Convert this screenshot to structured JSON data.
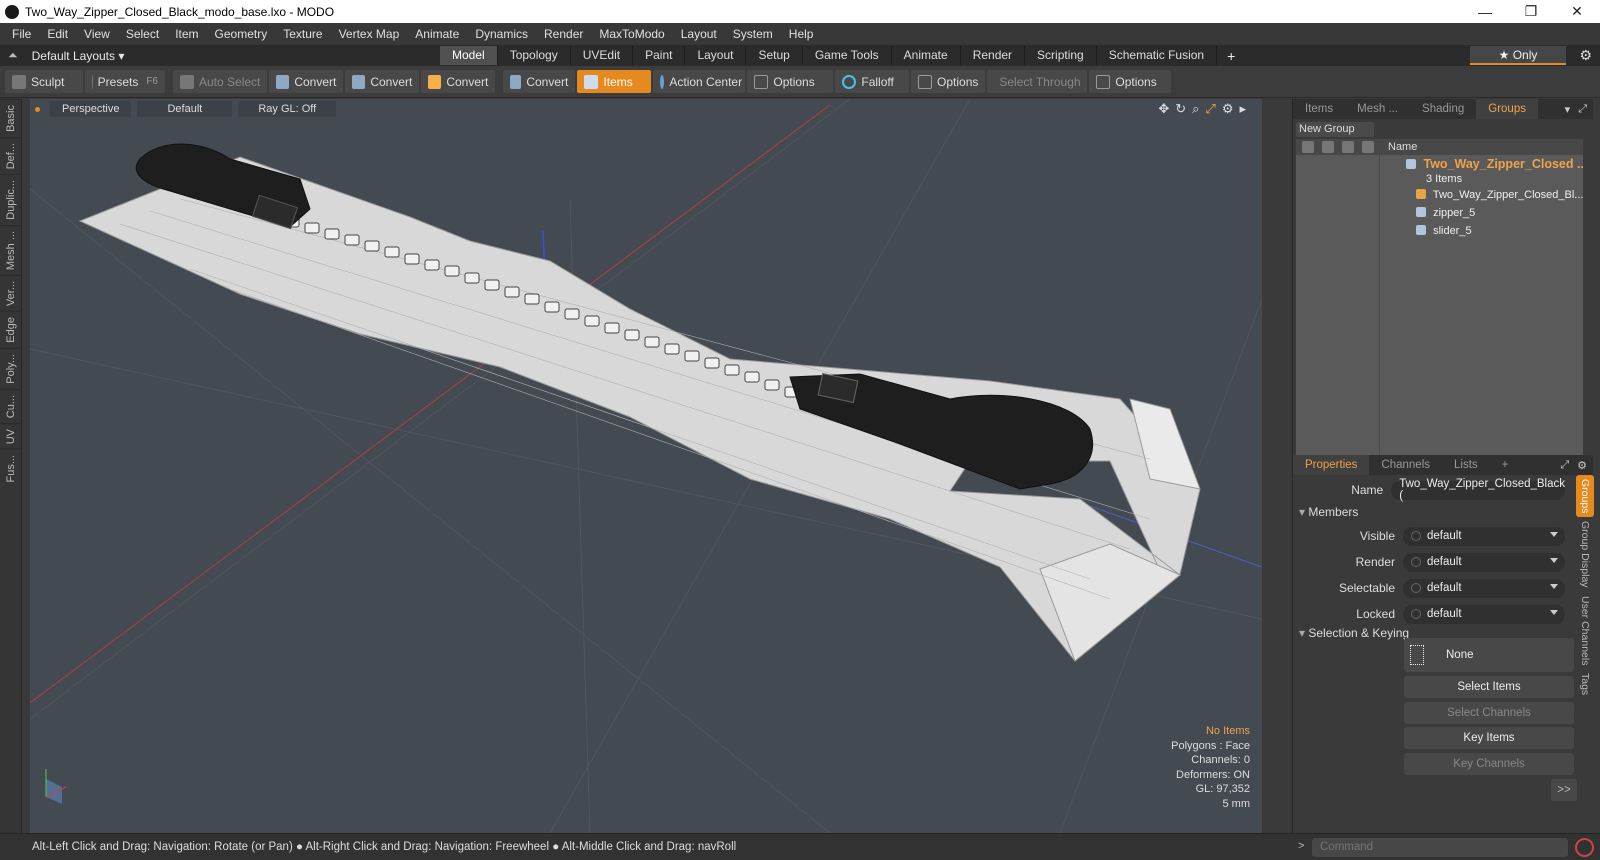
{
  "window": {
    "title": "Two_Way_Zipper_Closed_Black_modo_base.lxo - MODO",
    "minimize": "—",
    "maximize": "❐",
    "close": "✕"
  },
  "menu": [
    "File",
    "Edit",
    "View",
    "Select",
    "Item",
    "Geometry",
    "Texture",
    "Vertex Map",
    "Animate",
    "Dynamics",
    "Render",
    "MaxToModo",
    "Layout",
    "System",
    "Help"
  ],
  "layouts": {
    "dropdown": "Default Layouts ▾",
    "tabs": [
      "Model",
      "Topology",
      "UVEdit",
      "Paint",
      "Layout",
      "Setup",
      "Game Tools",
      "Animate",
      "Render",
      "Scripting",
      "Schematic Fusion"
    ],
    "active_tab": "Model",
    "plus": "+",
    "only": "★  Only",
    "gear": "⚙"
  },
  "toolbar": {
    "sculpt": "Sculpt",
    "presets": "Presets",
    "presets_key": "F6",
    "auto_select": "Auto Select",
    "convert1": "Convert",
    "convert2": "Convert",
    "convert3": "Convert",
    "convert4": "Convert",
    "items": "Items",
    "action_center": "Action Center",
    "options1": "Options",
    "falloff": "Falloff",
    "options2": "Options",
    "select_through": "Select Through",
    "options3": "Options"
  },
  "left_tabs": [
    "Basic",
    "Def...",
    "Duplic...",
    "Mesh ...",
    "Ver...",
    "Edge",
    "Poly...",
    "Cu...",
    "UV",
    "Fus..."
  ],
  "viewport": {
    "view": "Perspective",
    "shading": "Default",
    "raygl": "Ray GL: Off",
    "info": {
      "no_items": "No Items",
      "polygons": "Polygons : Face",
      "channels": "Channels: 0",
      "deformers": "Deformers: ON",
      "gl": "GL: 97,352",
      "scale": "5 mm"
    }
  },
  "groups_panel": {
    "tabs": [
      "Items",
      "Mesh ...",
      "Shading",
      "Groups"
    ],
    "active_tab": "Groups",
    "new_group": "New Group",
    "column_name": "Name",
    "group_name": "Two_Way_Zipper_Closed ...",
    "group_count": "3 Items",
    "children": [
      "Two_Way_Zipper_Closed_Bl...",
      "zipper_5",
      "slider_5"
    ]
  },
  "properties_panel": {
    "tabs": [
      "Properties",
      "Channels",
      "Lists",
      "+"
    ],
    "active_tab": "Properties",
    "name_label": "Name",
    "name_value": "Two_Way_Zipper_Closed_Black (",
    "members_section": "Members",
    "rows": [
      {
        "label": "Visible",
        "value": "default"
      },
      {
        "label": "Render",
        "value": "default"
      },
      {
        "label": "Selectable",
        "value": "default"
      },
      {
        "label": "Locked",
        "value": "default"
      }
    ],
    "selection_section": "Selection & Keying",
    "none": "None",
    "select_items": "Select Items",
    "select_channels": "Select Channels",
    "key_items": "Key Items",
    "key_channels": "Key Channels",
    "more": ">>",
    "vtabs": [
      "Groups",
      "Group Display",
      "User Channels",
      "Tags"
    ]
  },
  "status": {
    "hint": "Alt-Left Click and Drag: Navigation: Rotate (or Pan) ● Alt-Right Click and Drag: Navigation: Freewheel ● Alt-Middle Click and Drag: navRoll",
    "command_placeholder": "Command",
    "arrow": ">"
  }
}
